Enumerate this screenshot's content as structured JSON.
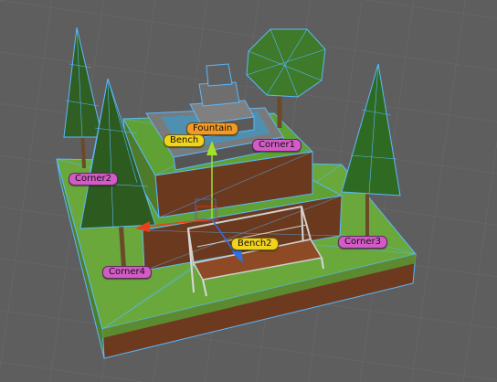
{
  "viewport": {
    "background": "#5e5e5e"
  },
  "colors": {
    "grass": "#6aa83c",
    "dirt": "#6e3a1f",
    "wireframe": "#5ab8ff",
    "tree": "#2f5f22",
    "stone": "#6f6f6f",
    "bench_wood": "#8d4a25",
    "axis_y": "#a3e02a",
    "axis_x": "#e8401c",
    "axis_z": "#2f6fe8",
    "label_object": "#d25bc6",
    "label_selected": "#f1d21d",
    "label_active": "#f29a26"
  },
  "labels": {
    "fountain": "Fountain",
    "bench": "Bench",
    "bench2": "Bench2",
    "corner1": "Corner1",
    "corner2": "Corner2",
    "corner3": "Corner3",
    "corner4": "Corner4"
  },
  "icons": {
    "move_gizmo": "move-gizmo-icon"
  }
}
